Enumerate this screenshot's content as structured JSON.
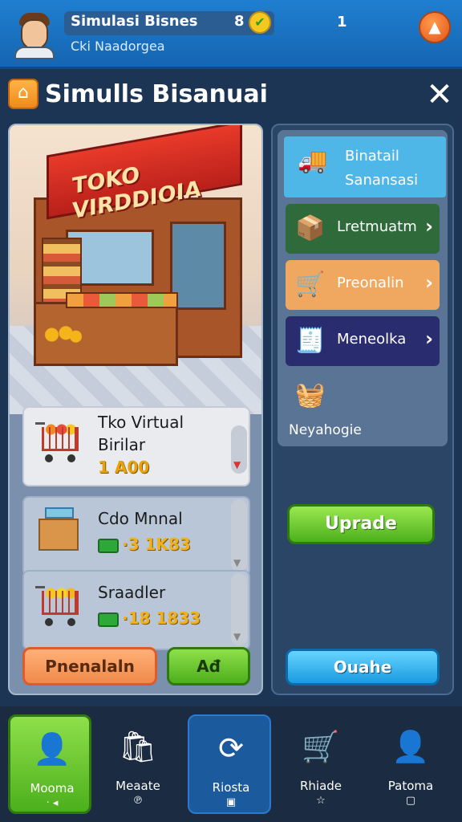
{
  "player": {
    "name": "Simulasi Bisnes",
    "level": "8",
    "subtitle": "Cki Naadorgea",
    "coins": "1"
  },
  "window": {
    "title": "Simulls Bisanuai"
  },
  "store": {
    "sign": "TOKO VIRDDIOIA"
  },
  "items": [
    {
      "name_line1": "Tko Virtual",
      "name_line2": "Birilar",
      "value": "1 A00"
    },
    {
      "name": "Cdo Mnnal",
      "value": "·3 1K83"
    },
    {
      "name": "Sraadler",
      "value": "·18 1833"
    }
  ],
  "left_buttons": {
    "orange": "Pnenalaln",
    "green": "Ađ"
  },
  "menu": [
    {
      "line1": "Binatail",
      "line2": "Sanansasi"
    },
    {
      "label": "Lretmuatm"
    },
    {
      "label": "Preonalin"
    },
    {
      "label": "Meneolka"
    },
    {
      "label": "Neyahogie"
    }
  ],
  "right_buttons": {
    "upgrade": "Uprade",
    "blue": "Ouahe"
  },
  "nav": [
    {
      "label": "Mooma",
      "sub": "· ◂"
    },
    {
      "label": "Meaate",
      "sub": "℗"
    },
    {
      "label": "Riosta",
      "sub": "▣"
    },
    {
      "label": "Rhiade",
      "sub": "☆"
    },
    {
      "label": "Patoma",
      "sub": "▢"
    }
  ],
  "colors": {
    "topbar": "#1f7fd0",
    "accent_green": "#4caf1c",
    "accent_orange": "#f08a4a",
    "accent_blue": "#1a9be0",
    "panel_dark": "#2a4565"
  }
}
